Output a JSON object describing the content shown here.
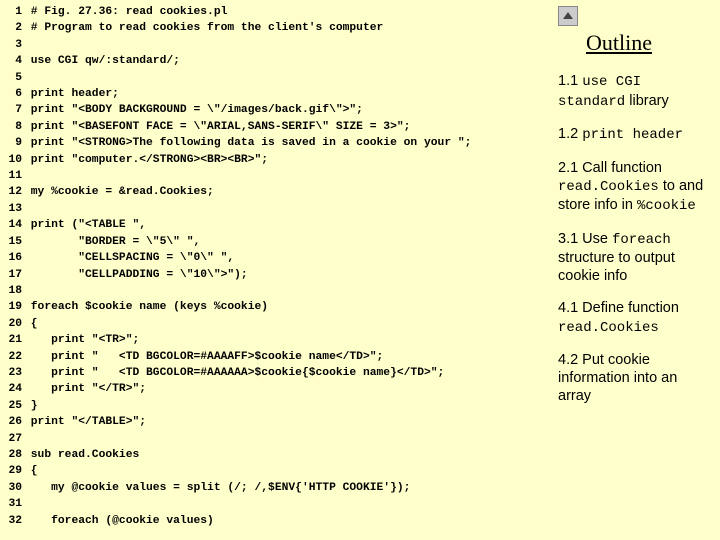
{
  "code": {
    "lines": [
      {
        "n": 1,
        "t": "# Fig. 27.36: read cookies.pl"
      },
      {
        "n": 2,
        "t": "# Program to read cookies from the client's computer"
      },
      {
        "n": 3,
        "t": ""
      },
      {
        "n": 4,
        "t": "use CGI qw/:standard/;"
      },
      {
        "n": 5,
        "t": ""
      },
      {
        "n": 6,
        "t": "print header;"
      },
      {
        "n": 7,
        "t": "print \"<BODY BACKGROUND = \\\"/images/back.gif\\\">\";"
      },
      {
        "n": 8,
        "t": "print \"<BASEFONT FACE = \\\"ARIAL,SANS-SERIF\\\" SIZE = 3>\";"
      },
      {
        "n": 9,
        "t": "print \"<STRONG>The following data is saved in a cookie on your \";"
      },
      {
        "n": 10,
        "t": "print \"computer.</STRONG><BR><BR>\";"
      },
      {
        "n": 11,
        "t": ""
      },
      {
        "n": 12,
        "t": "my %cookie = &read.Cookies;"
      },
      {
        "n": 13,
        "t": ""
      },
      {
        "n": 14,
        "t": "print (\"<TABLE \","
      },
      {
        "n": 15,
        "t": "       \"BORDER = \\\"5\\\" \","
      },
      {
        "n": 16,
        "t": "       \"CELLSPACING = \\\"0\\\" \","
      },
      {
        "n": 17,
        "t": "       \"CELLPADDING = \\\"10\\\">\");"
      },
      {
        "n": 18,
        "t": ""
      },
      {
        "n": 19,
        "t": "foreach $cookie name (keys %cookie)"
      },
      {
        "n": 20,
        "t": "{"
      },
      {
        "n": 21,
        "t": "   print \"<TR>\";"
      },
      {
        "n": 22,
        "t": "   print \"   <TD BGCOLOR=#AAAAFF>$cookie name</TD>\";"
      },
      {
        "n": 23,
        "t": "   print \"   <TD BGCOLOR=#AAAAAA>$cookie{$cookie name}</TD>\";"
      },
      {
        "n": 24,
        "t": "   print \"</TR>\";"
      },
      {
        "n": 25,
        "t": "}"
      },
      {
        "n": 26,
        "t": "print \"</TABLE>\";"
      },
      {
        "n": 27,
        "t": ""
      },
      {
        "n": 28,
        "t": "sub read.Cookies"
      },
      {
        "n": 29,
        "t": "{"
      },
      {
        "n": 30,
        "t": "   my @cookie values = split (/; /,$ENV{'HTTP COOKIE'});"
      },
      {
        "n": 31,
        "t": ""
      },
      {
        "n": 32,
        "t": "   foreach (@cookie values)"
      }
    ]
  },
  "outline": {
    "title": "Outline",
    "items": [
      {
        "pre": "1.1 ",
        "mono": "use CGI standard",
        "post": " library"
      },
      {
        "pre": "1.2 ",
        "mono": "print header",
        "post": ""
      },
      {
        "pre": "2.1 Call function ",
        "mono": "read.Cookies",
        "post": " to and store info in ",
        "mono2": "%cookie"
      },
      {
        "pre": "3.1 Use ",
        "mono": "foreach",
        "post": " structure to output cookie info"
      },
      {
        "pre": "4.1 Define function ",
        "mono": "read.Cookies",
        "post": ""
      },
      {
        "pre": "4.2 Put cookie information into an array",
        "mono": "",
        "post": ""
      }
    ]
  }
}
